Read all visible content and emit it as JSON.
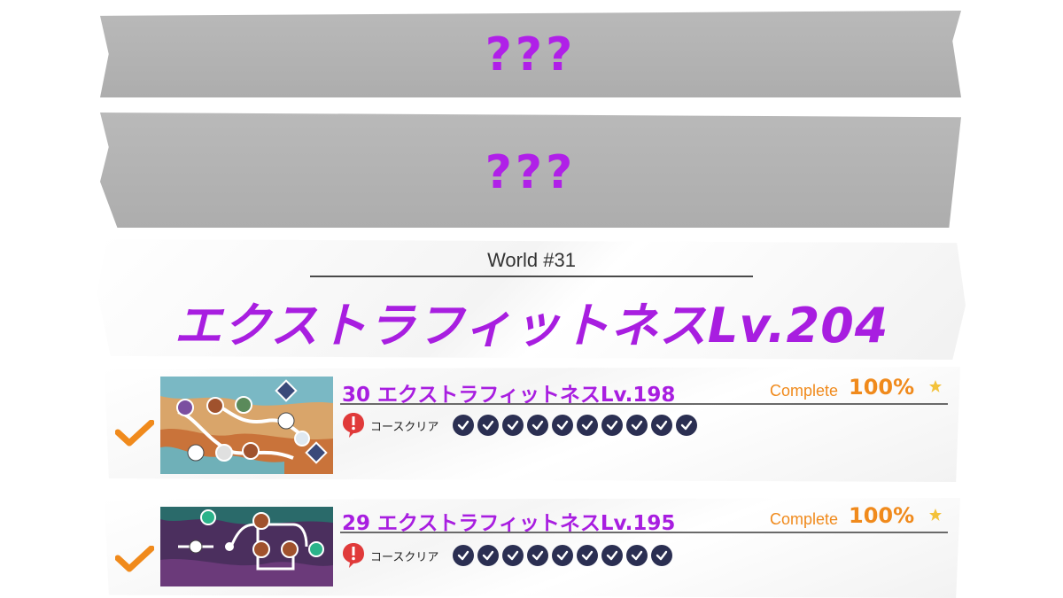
{
  "locked_worlds": [
    {
      "label": "???"
    },
    {
      "label": "???"
    }
  ],
  "world": {
    "number_label": "World #31",
    "title": "エクストラフィットネスLv.204"
  },
  "courses": [
    {
      "title": "30 エクストラフィットネスLv.198",
      "complete_label": "Complete",
      "complete_pct": "100%",
      "clear_label": "コースクリア",
      "cleared_count": 10,
      "status": "completed"
    },
    {
      "title": "29 エクストラフィットネスLv.195",
      "complete_label": "Complete",
      "complete_pct": "100%",
      "clear_label": "コースクリア",
      "cleared_count": 9,
      "status": "completed"
    }
  ],
  "colors": {
    "accent_purple": "#a81ee0",
    "orange": "#f08a1c",
    "check_dot": "#2b2f52",
    "alert_red": "#e03a3a"
  }
}
